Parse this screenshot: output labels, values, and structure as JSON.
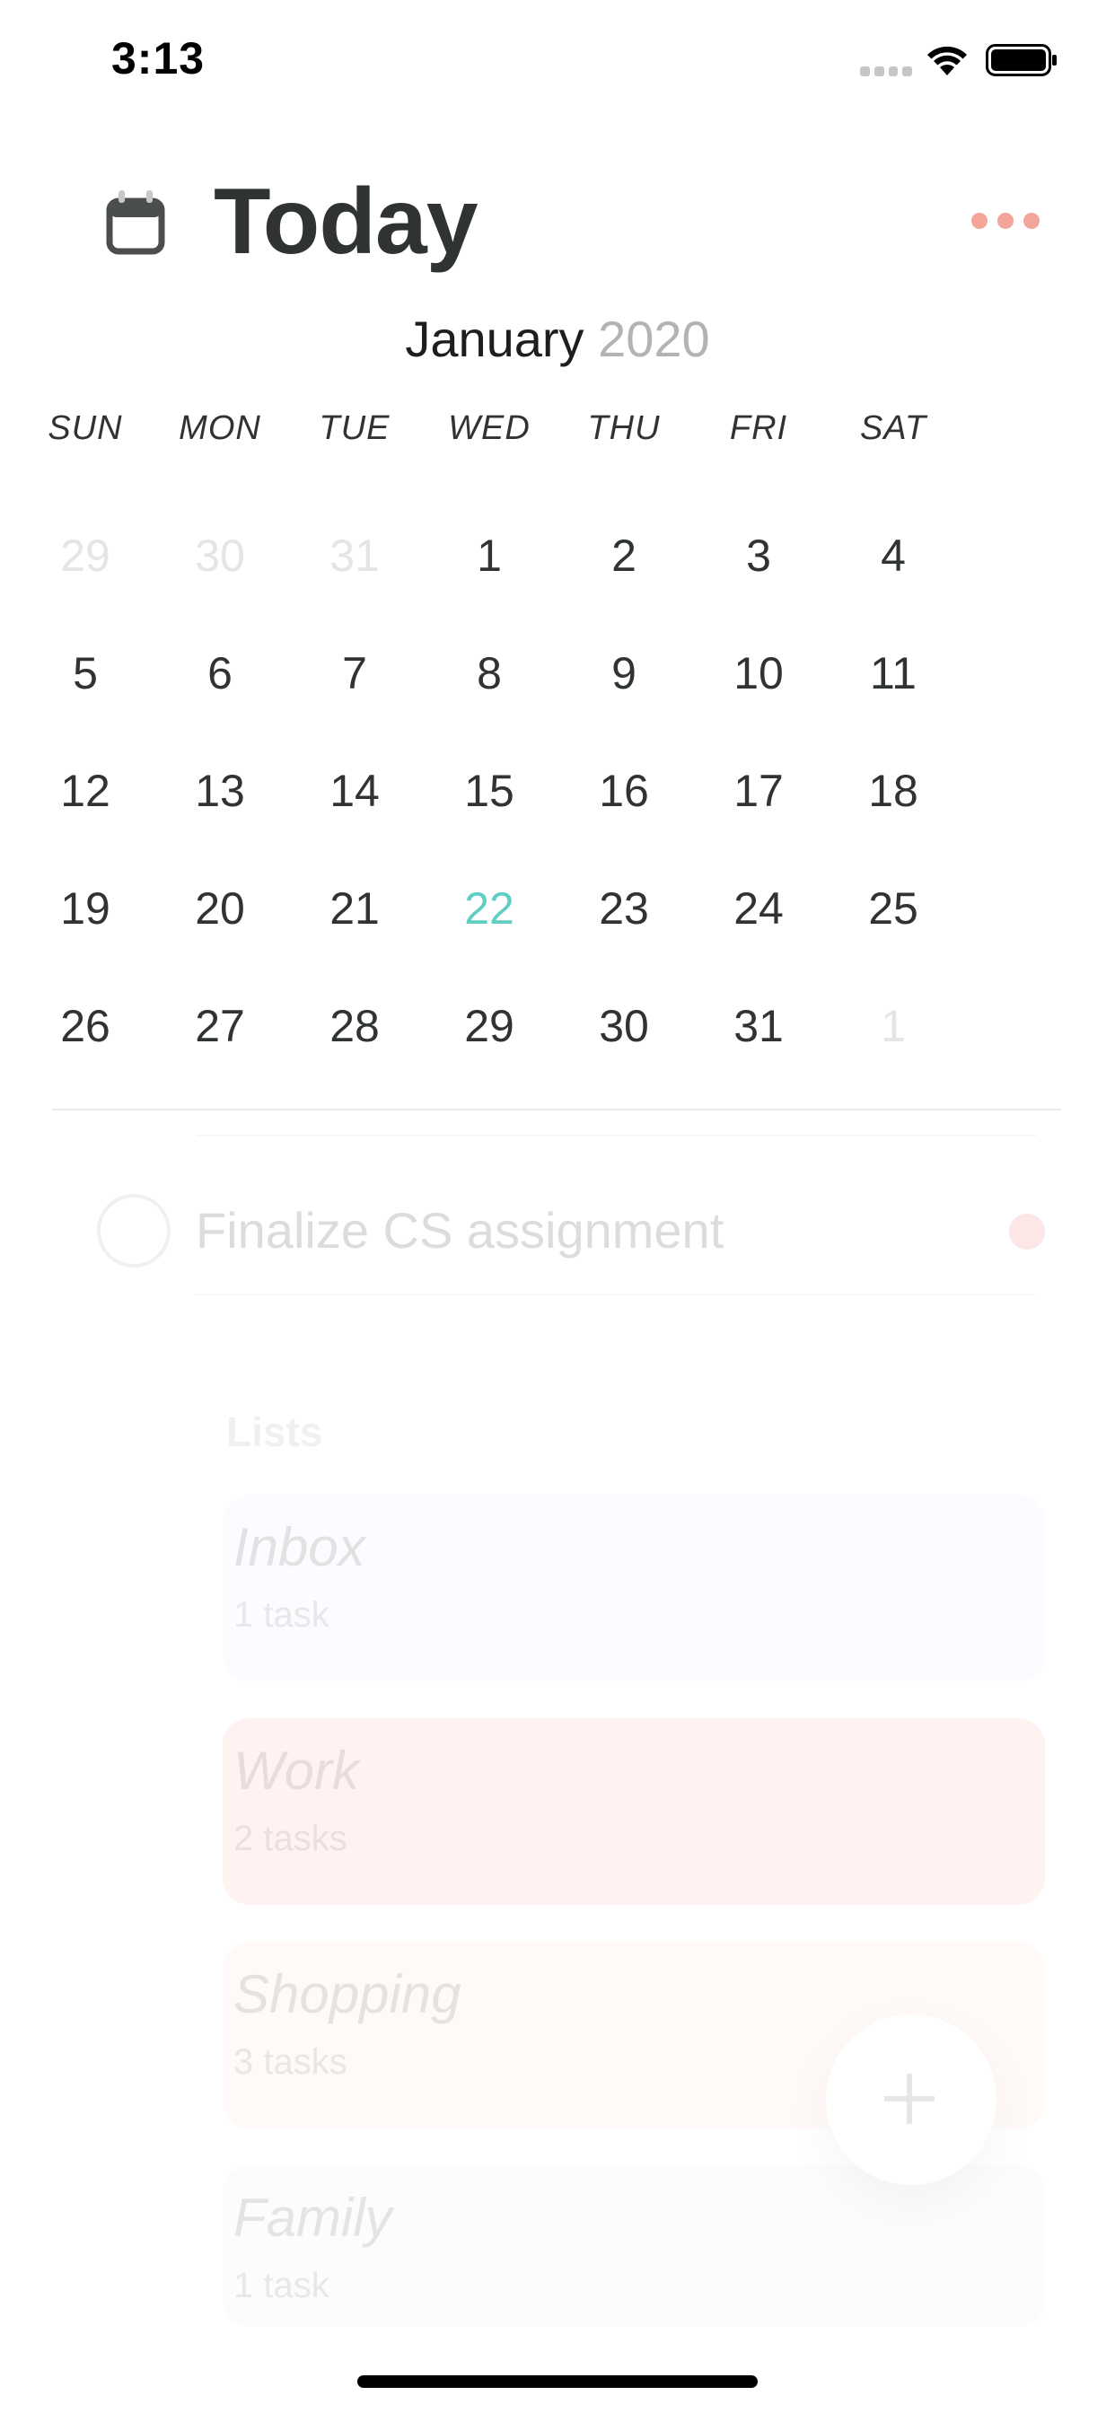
{
  "status_bar": {
    "time": "3:13"
  },
  "header": {
    "title": "Today"
  },
  "calendar": {
    "month": "January",
    "year": "2020",
    "weekdays": [
      "SUN",
      "MON",
      "TUE",
      "WED",
      "THU",
      "FRI",
      "SAT"
    ],
    "weeks": [
      [
        "29",
        "30",
        "31",
        "1",
        "2",
        "3",
        "4"
      ],
      [
        "5",
        "6",
        "7",
        "8",
        "9",
        "10",
        "11"
      ],
      [
        "12",
        "13",
        "14",
        "15",
        "16",
        "17",
        "18"
      ],
      [
        "19",
        "20",
        "21",
        "22",
        "23",
        "24",
        "25"
      ],
      [
        "26",
        "27",
        "28",
        "29",
        "30",
        "31",
        "1"
      ]
    ],
    "today": "22"
  },
  "task": {
    "title": "Finalize CS assignment"
  },
  "lists": {
    "heading": "Lists",
    "items": [
      {
        "name": "Inbox",
        "count": "1 task"
      },
      {
        "name": "Work",
        "count": "2 tasks"
      },
      {
        "name": "Shopping",
        "count": "3 tasks"
      },
      {
        "name": "Family",
        "count": "1 task"
      }
    ]
  },
  "colors": {
    "accent": "#f3a59a",
    "today": "#5fcfc4",
    "title": "#2f3331",
    "inbox_bg": "#fbfcff",
    "work_bg": "#fff3f1",
    "shopping_bg": "#fffaf7",
    "family_bg": "#fcfcfc"
  },
  "icons": {
    "calendar": "calendar-icon",
    "more": "more-dots-icon",
    "add": "plus-icon",
    "wifi": "wifi-icon",
    "battery": "battery-icon"
  }
}
